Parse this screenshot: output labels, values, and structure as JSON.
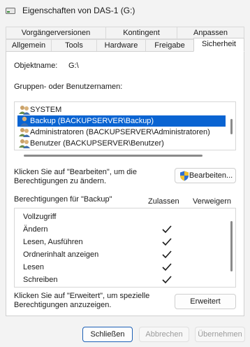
{
  "window": {
    "title": "Eigenschaften von DAS-1 (G:)"
  },
  "tabs_row1": [
    {
      "label": "Vorgängerversionen"
    },
    {
      "label": "Kontingent"
    },
    {
      "label": "Anpassen"
    }
  ],
  "tabs_row2": [
    {
      "label": "Allgemein"
    },
    {
      "label": "Tools"
    },
    {
      "label": "Hardware"
    },
    {
      "label": "Freigabe"
    },
    {
      "label": "Sicherheit",
      "active": true
    }
  ],
  "object": {
    "label": "Objektname:",
    "value": "G:\\"
  },
  "groups": {
    "label": "Gruppen- oder Benutzernamen:",
    "items": [
      {
        "name": "SYSTEM"
      },
      {
        "name": "Backup (BACKUPSERVER\\Backup)",
        "selected": true
      },
      {
        "name": "Administratoren (BACKUPSERVER\\Administratoren)"
      },
      {
        "name": "Benutzer (BACKUPSERVER\\Benutzer)"
      }
    ]
  },
  "edit": {
    "hint": "Klicken Sie auf \"Bearbeiten\", um die\nBerechtigungen zu ändern.",
    "hint_line1": "Klicken Sie auf \"Bearbeiten\", um die",
    "hint_line2": "Berechtigungen zu ändern.",
    "button_label": "Bearbeiten..."
  },
  "permissions": {
    "header_label": "Berechtigungen für \"Backup\"",
    "allow_label": "Zulassen",
    "deny_label": "Verweigern",
    "rows": [
      {
        "name": "Vollzugriff",
        "allow": false,
        "deny": false
      },
      {
        "name": "Ändern",
        "allow": true,
        "deny": false
      },
      {
        "name": "Lesen, Ausführen",
        "allow": true,
        "deny": false
      },
      {
        "name": "Ordnerinhalt anzeigen",
        "allow": true,
        "deny": false
      },
      {
        "name": "Lesen",
        "allow": true,
        "deny": false
      },
      {
        "name": "Schreiben",
        "allow": true,
        "deny": false
      }
    ]
  },
  "advanced": {
    "hint_line1": "Klicken Sie auf \"Erweitert\", um spezielle",
    "hint_line2": "Berechtigungen anzuzeigen.",
    "button_label": "Erweitert"
  },
  "footer": {
    "close_label": "Schließen",
    "cancel_label": "Abbrechen",
    "apply_label": "Übernehmen"
  },
  "colors": {
    "accent": "#0a64d2",
    "window_bg": "#f3f3f3",
    "panel_bg": "#ffffff"
  },
  "icons": {
    "title": "drive-icon",
    "group": "user-group-icon",
    "user": "user-icon",
    "shield": "uac-shield-icon",
    "check": "checkmark-icon"
  }
}
